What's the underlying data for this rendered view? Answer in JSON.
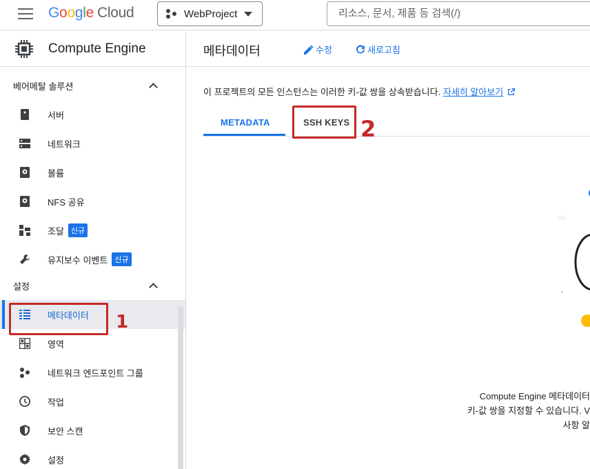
{
  "header": {
    "logo": {
      "google_parts": [
        "G",
        "o",
        "o",
        "g",
        "l",
        "e"
      ],
      "cloud": "Cloud"
    },
    "project": "WebProject",
    "search_placeholder": "리소스, 문서, 제품 등 검색(/)"
  },
  "sidebar": {
    "product_title": "Compute Engine",
    "sections": [
      {
        "title": "베어메탈 솔루션",
        "items": [
          {
            "label": "서버",
            "icon": "server-icon"
          },
          {
            "label": "네트워크",
            "icon": "network-icon"
          },
          {
            "label": "볼륨",
            "icon": "volume-icon"
          },
          {
            "label": "NFS 공유",
            "icon": "nfs-share-icon"
          },
          {
            "label": "조달",
            "icon": "procurement-icon",
            "badge": "신규"
          },
          {
            "label": "유지보수 이벤트",
            "icon": "wrench-icon",
            "badge": "신규"
          }
        ]
      },
      {
        "title": "설정",
        "items": [
          {
            "label": "메타데이터",
            "icon": "metadata-list-icon",
            "active": true
          },
          {
            "label": "영역",
            "icon": "zones-icon"
          },
          {
            "label": "네트워크 엔드포인트 그룹",
            "icon": "endpoint-group-icon"
          },
          {
            "label": "작업",
            "icon": "clock-icon"
          },
          {
            "label": "보안 스캔",
            "icon": "shield-icon"
          },
          {
            "label": "설정",
            "icon": "gear-icon"
          }
        ]
      }
    ]
  },
  "main": {
    "title": "메타데이터",
    "edit_label": "수정",
    "refresh_label": "새로고침",
    "info_text": "이 프로젝트의 모든 인스턴스는 이러한 키-값 쌍을 상속받습니다.",
    "info_link": "자세히 알아보기",
    "tabs": [
      "METADATA",
      "SSH KEYS"
    ],
    "empty_lines": [
      "Compute Engine 메타데이터",
      "키-값 쌍을 지정할 수 있습니다. V",
      "사항 알"
    ]
  },
  "annotations": [
    "1",
    "2"
  ],
  "colors": {
    "accent": "#1a73e8",
    "annotation": "#c62828"
  }
}
